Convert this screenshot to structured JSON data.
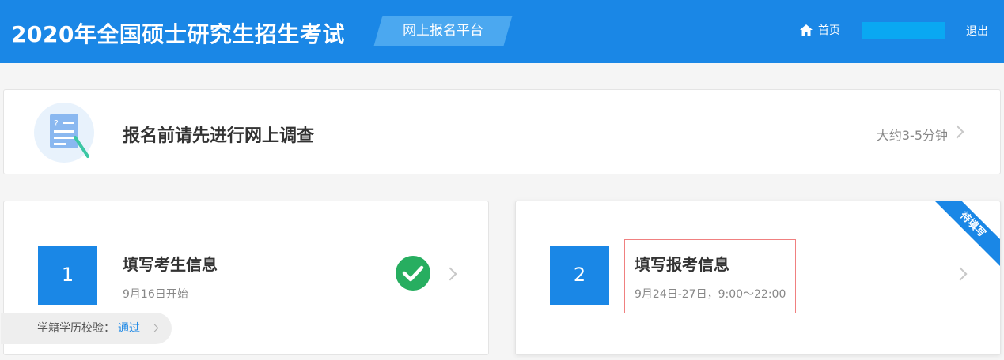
{
  "header": {
    "title": "2020年全国硕士研究生招生考试",
    "platform": "网上报名平台",
    "home": "首页",
    "logout": "退出"
  },
  "survey": {
    "title": "报名前请先进行网上调查",
    "hint": "大约3-5分钟"
  },
  "steps": [
    {
      "number": "1",
      "title": "填写考生信息",
      "subtitle": "9月16日开始",
      "verify_label": "学籍学历校验：",
      "verify_status": "通过"
    },
    {
      "number": "2",
      "title": "填写报考信息",
      "subtitle": "9月24日-27日，9:00～22:00",
      "ribbon": "待填写"
    }
  ],
  "colors": {
    "header_bg": "#1a87e6",
    "platform_tag": "#4ba8f0",
    "step_box": "#1a87e6",
    "check": "#27ae60",
    "highlight_border": "#f08080"
  },
  "icons": {
    "home": "home-icon",
    "survey": "questionnaire-icon",
    "done": "check-circle-icon",
    "next": "chevron-right-icon"
  }
}
